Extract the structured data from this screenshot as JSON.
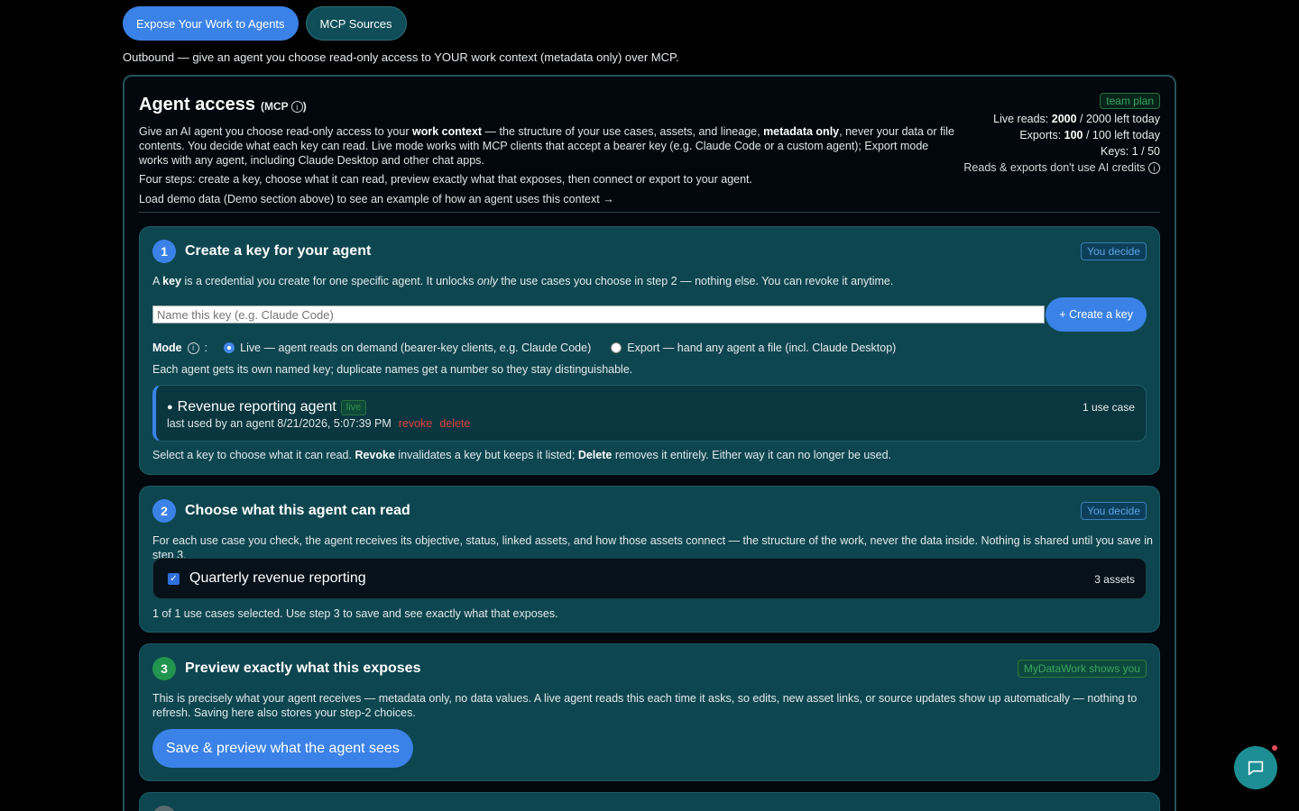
{
  "tabs": [
    {
      "label": "Expose Your Work to Agents"
    },
    {
      "label": "MCP Sources"
    }
  ],
  "subtitle": "Outbound — give an agent you choose read-only access to YOUR work context (metadata only) over MCP.",
  "header": {
    "title": "Agent access",
    "title_suffix": "(MCP",
    "title_close": ")",
    "info_glyph": "i",
    "intro_1": "Give an AI agent you choose read-only access to your ",
    "intro_bold_1": "work context",
    "intro_2": " — the structure of your use cases, assets, and lineage, ",
    "intro_bold_2": "metadata only",
    "intro_3": ", never your data or file contents. You decide what each key can read. Live mode works with MCP clients that accept a bearer key (e.g. Claude Code or a custom agent); Export mode works with any agent, including Claude Desktop and other chat apps.",
    "steps_summary": "Four steps: create a key, choose what it can read, preview exactly what that exposes, then connect or export to your agent.",
    "demo_hint": "Load demo data (Demo section above) to see an example of how an agent uses this context →"
  },
  "quota": {
    "plan_badge": "team plan",
    "live_reads_label": "Live reads: ",
    "live_reads_value": "2000",
    "live_reads_rest": " / 2000 left today",
    "exports_label": "Exports: ",
    "exports_value": "100",
    "exports_rest": " / 100 left today",
    "keys": "Keys: 1 / 50",
    "credits_note": "Reads & exports don't use AI credits"
  },
  "step1": {
    "number": "1",
    "title": "Create a key for your agent",
    "tag": "You decide",
    "desc_1": "A ",
    "desc_bold": "key",
    "desc_2": " is a credential you create for one specific agent. It unlocks ",
    "desc_italic": "only",
    "desc_3": " the use cases you choose in step 2 — nothing else. You can revoke it anytime.",
    "input_placeholder": "Name this key (e.g. Claude Code)",
    "create_label": "+ Create a key",
    "mode_label": "Mode",
    "mode_colon": ":",
    "mode_live": "Live — agent reads on demand (bearer-key clients, e.g. Claude Code)",
    "mode_export": "Export — hand any agent a file (incl. Claude Desktop)",
    "dup_note": "Each agent gets its own named key; duplicate names get a number so they stay distinguishable.",
    "key": {
      "bullet": "●",
      "name": "Revenue reporting agent",
      "status": "live",
      "last_used": "last used by an agent 8/21/2026, 5:07:39 PM",
      "revoke": "revoke",
      "delete": "delete",
      "use_cases": "1 use case"
    },
    "footer_1": "Select a key to choose what it can read. ",
    "footer_bold_1": "Revoke",
    "footer_2": " invalidates a key but keeps it listed; ",
    "footer_bold_2": "Delete",
    "footer_3": " removes it entirely. Either way it can no longer be used."
  },
  "step2": {
    "number": "2",
    "title": "Choose what this agent can read",
    "tag": "You decide",
    "desc": "For each use case you check, the agent receives its objective, status, linked assets, and how those assets connect — the structure of the work, never the data inside. Nothing is shared until you save in step 3.",
    "use_case": {
      "name": "Quarterly revenue reporting",
      "assets": "3 assets",
      "check": "✓"
    },
    "footer": "1 of 1 use cases selected. Use step 3 to save and see exactly what that exposes."
  },
  "step3": {
    "number": "3",
    "title": "Preview exactly what this exposes",
    "tag": "MyDataWork shows you",
    "desc": "This is precisely what your agent receives — metadata only, no data values. A live agent reads this each time it asks, so edits, new asset links, or source updates show up automatically — nothing to refresh. Saving here also stores your step-2 choices.",
    "save_label": "Save & preview what the agent sees"
  },
  "colors": {
    "accent": "#3b82e8",
    "panel": "#0e4650",
    "danger": "#d9433a",
    "success": "#3aa660"
  }
}
